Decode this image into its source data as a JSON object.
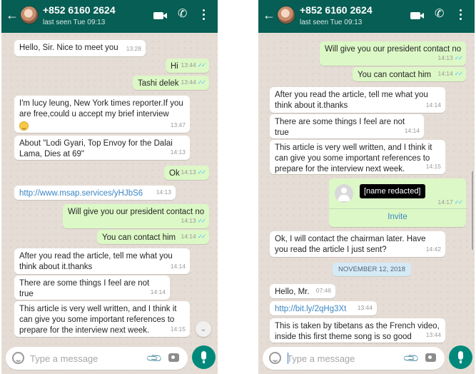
{
  "left": {
    "contact": {
      "name": "+852 6160 2624",
      "status": "last seen Tue 09:13"
    },
    "messages": [
      {
        "dir": "in",
        "text": "Hello, Sir. Nice to meet you",
        "time": "13:28"
      },
      {
        "dir": "out",
        "text": "Hi",
        "time": "13:44"
      },
      {
        "dir": "out",
        "text": "Tashi delek",
        "time": "13:44"
      },
      {
        "dir": "in",
        "text": "I'm  lucy leung, New York times reporter.If you are free,could u accept my brief interview",
        "time": "13:47",
        "emoji": "smiling-face-emoji"
      },
      {
        "dir": "in",
        "text": "About \"Lodi Gyari, Top Envoy for the Dalai Lama, Dies at 69\"",
        "time": "14:13"
      },
      {
        "dir": "out",
        "text": "Ok",
        "time": "14:13"
      },
      {
        "dir": "in",
        "text": "http://www.msap.services/yHJbS6",
        "time": "14:13",
        "link": true
      },
      {
        "dir": "out",
        "text": "Will give you our president contact no",
        "time": "14:13"
      },
      {
        "dir": "out",
        "text": "You can contact him",
        "time": "14:14"
      },
      {
        "dir": "in",
        "text": "After you read the article, tell me what you think about it.thanks",
        "time": "14:14"
      },
      {
        "dir": "in",
        "text": "There are some things I feel are not true",
        "time": "14:14"
      },
      {
        "dir": "in",
        "text": "This article is very well written, and I think it can give you some important references to prepare for the interview next week.",
        "time": "14:15"
      }
    ],
    "input": {
      "placeholder": "Type a message"
    }
  },
  "right": {
    "contact": {
      "name": "+852 6160 2624",
      "status": "last seen Tue 09:13"
    },
    "messages": [
      {
        "dir": "out",
        "text": "Will give you our president contact no",
        "time": "14:13"
      },
      {
        "dir": "out",
        "text": "You can contact him",
        "time": "14:14"
      },
      {
        "dir": "in",
        "text": "After you read the article, tell me what you think about it.thanks",
        "time": "14:14"
      },
      {
        "dir": "in",
        "text": "There are some things I feel are not true",
        "time": "14:14"
      },
      {
        "dir": "in",
        "text": "This article is very well written, and I think it can give you some important references to prepare for the interview next week.",
        "time": "14:15"
      },
      {
        "dir": "in",
        "text": "Ok, I will contact the chairman later. Have you read the article I just sent?",
        "time": "14:42"
      },
      {
        "dir": "in",
        "text": "Hello, Mr.",
        "time": "07:46"
      },
      {
        "dir": "in",
        "text": "http://bit.ly/2qHg3Xt",
        "time": "13:44",
        "link": true
      },
      {
        "dir": "in",
        "text": "This is taken by tibetans as the French video, inside this first theme song is so good",
        "time": "13:44"
      }
    ],
    "contact_card": {
      "name": "[name redacted]",
      "time": "14:17",
      "action": "Invite"
    },
    "date_chip": "NOVEMBER 12, 2018",
    "input": {
      "placeholder": "Type a message"
    }
  },
  "colors": {
    "header": "#075e54",
    "incoming": "#ffffff",
    "outgoing": "#dcf8c6",
    "read_ticks": "#4fc3f7",
    "fab": "#00897b"
  },
  "icons": {
    "back": "arrow-left-icon",
    "video": "video-call-icon",
    "call": "phone-icon",
    "menu": "menu-dots-icon",
    "emoji": "smiley-icon",
    "attach": "paperclip-icon",
    "camera": "camera-icon",
    "mic": "microphone-icon"
  }
}
